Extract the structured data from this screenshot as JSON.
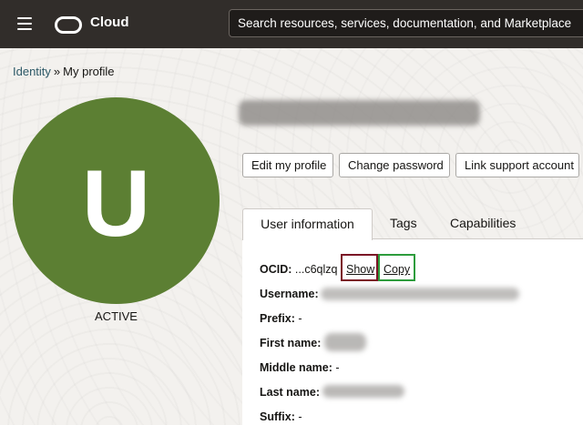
{
  "header": {
    "brand": "Cloud",
    "search_placeholder": "Search resources, services, documentation, and Marketplace"
  },
  "breadcrumb": {
    "items": [
      "Identity",
      "My profile"
    ],
    "separator": "»"
  },
  "profile": {
    "avatar_letter": "U",
    "status": "ACTIVE",
    "avatar_color": "#5c7f33"
  },
  "actions": {
    "edit": "Edit my profile",
    "change_password": "Change password",
    "link_support": "Link support account"
  },
  "tabs": [
    "User information",
    "Tags",
    "Capabilities"
  ],
  "details": {
    "ocid_label": "OCID:",
    "ocid_value": "...c6qlzq",
    "show": "Show",
    "copy": "Copy",
    "username_label": "Username:",
    "prefix_label": "Prefix:",
    "prefix_value": "-",
    "first_name_label": "First name:",
    "middle_name_label": "Middle name:",
    "middle_name_value": "-",
    "last_name_label": "Last name:",
    "suffix_label": "Suffix:",
    "suffix_value": "-"
  },
  "colors": {
    "header_bg": "#312d2a",
    "show_highlight": "#7b1526",
    "copy_highlight": "#2d9c3c"
  }
}
